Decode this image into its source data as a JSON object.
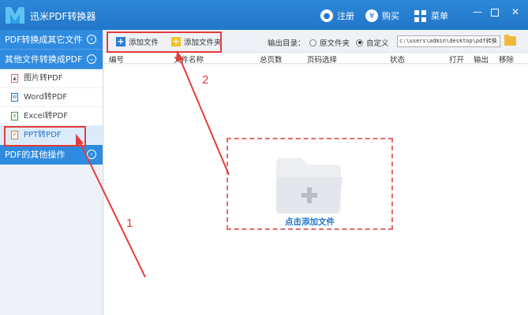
{
  "app": {
    "title": "迅米PDF转换器"
  },
  "titlebar": {
    "register_label": "注册",
    "buy_label": "购买",
    "menu_label": "菜单"
  },
  "sidebar": {
    "section1": "PDF转换成其它文件",
    "section2": "其他文件转换成PDF",
    "items": [
      {
        "label": "图片转PDF",
        "icon": "image-file-icon"
      },
      {
        "label": "Word转PDF",
        "icon": "word-file-icon"
      },
      {
        "label": "Excel转PDF",
        "icon": "excel-file-icon"
      },
      {
        "label": "PPT转PDF",
        "icon": "ppt-file-icon"
      }
    ],
    "section3": "PDF的其他操作"
  },
  "toolbar": {
    "add_file": "添加文件",
    "add_folder": "添加文件夹",
    "output_label": "输出目录：",
    "radio_original": "原文件夹",
    "radio_custom": "自定义",
    "path_value": "c:\\users\\admin\\desktop\\pdf转换"
  },
  "table": {
    "columns": [
      "编号",
      "文件名称",
      "总页数",
      "页码选择",
      "状态",
      "打开",
      "输出",
      "移除"
    ]
  },
  "dropzone": {
    "label": "点击添加文件"
  },
  "annotations": {
    "one": "1",
    "two": "2"
  },
  "colors": {
    "accent": "#2277c9",
    "annotation": "#e43b3b",
    "dropzone_border": "#e36b6b"
  }
}
